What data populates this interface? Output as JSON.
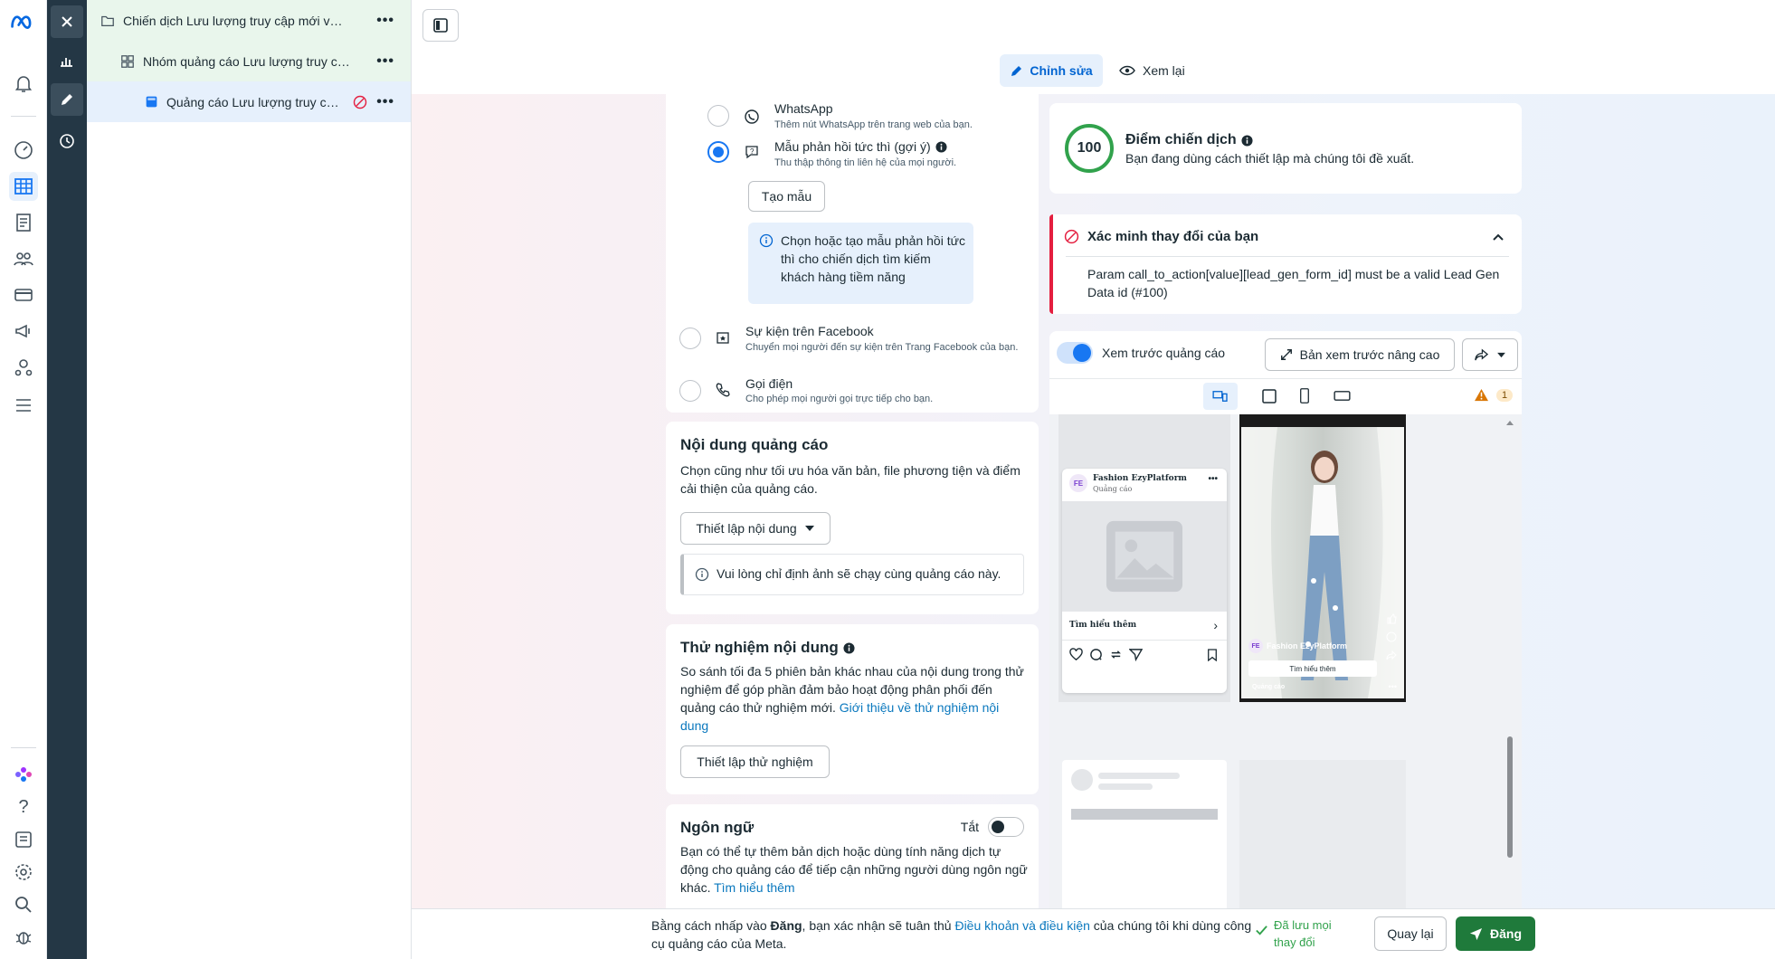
{
  "tree": {
    "campaign": "Chiến dịch Lưu lượng truy cập mới với ...",
    "adset": "Nhóm quảng cáo Lưu lượng truy cậ...",
    "ad": "Quảng cáo Lưu lượng truy câ...",
    "more": "•••"
  },
  "tabs": {
    "edit": "Chỉnh sửa",
    "review": "Xem lại"
  },
  "destinations": {
    "whatsapp_title": "WhatsApp",
    "whatsapp_desc": "Thêm nút WhatsApp trên trang web của bạn.",
    "instant_title": "Mẫu phản hồi tức thì (gợi ý)",
    "instant_desc": "Thu thập thông tin liên hệ của mọi người.",
    "create_form": "Tạo mẫu",
    "info": "Chọn hoặc tạo mẫu phản hồi tức thì cho chiến dịch tìm kiếm khách hàng tiềm năng",
    "event_title": "Sự kiện trên Facebook",
    "event_desc": "Chuyển mọi người đến sự kiện trên Trang Facebook của bạn.",
    "call_title": "Gọi điện",
    "call_desc": "Cho phép mọi người gọi trực tiếp cho bạn."
  },
  "ad_content": {
    "title": "Nội dung quảng cáo",
    "desc": "Chọn cũng như tối ưu hóa văn bản, file phương tiện và điểm cải thiện của quảng cáo.",
    "setup": "Thiết lập nội dung",
    "notice": "Vui lòng chỉ định ảnh sẽ chạy cùng quảng cáo này."
  },
  "content_test": {
    "title": "Thử nghiệm nội dung",
    "desc": "So sánh tối đa 5 phiên bản khác nhau của nội dung trong thử nghiệm để góp phần đảm bảo hoạt động phân phối đến quảng cáo thử nghiệm mới.",
    "link": "Giới thiệu về thử nghiệm nội dung",
    "button": "Thiết lập thử nghiệm"
  },
  "language": {
    "title": "Ngôn ngữ",
    "toggle": "Tắt",
    "desc": "Bạn có thể tự thêm bản dịch hoặc dùng tính năng dịch tự động cho quảng cáo để tiếp cận những người dùng ngôn ngữ khác.",
    "link": "Tìm hiểu thêm"
  },
  "score": {
    "value": "100",
    "title": "Điểm chiến dịch",
    "desc": "Bạn đang dùng cách thiết lập mà chúng tôi đề xuất."
  },
  "verify": {
    "title": "Xác minh thay đổi của bạn",
    "error": "Param call_to_action[value][lead_gen_form_id] must be a valid Lead Gen Data id (#100)"
  },
  "preview": {
    "toggle_label": "Xem trước quảng cáo",
    "advanced": "Bản xem trước nâng cao",
    "warning_count": "1",
    "page_name": "Fashion EzyPlatform",
    "sponsored": "Quảng cáo",
    "cta": "Tìm hiểu thêm",
    "logo": "FE"
  },
  "footer": {
    "terms_prefix": "Bằng cách nhấp vào ",
    "terms_bold": "Đăng",
    "terms_mid": ", bạn xác nhận sẽ tuân thủ ",
    "terms_link": "Điều khoản và điều kiện",
    "terms_suffix": " của chúng tôi khi dùng công cụ quảng cáo của Meta.",
    "saved": "Đã lưu mọi thay đổi",
    "back": "Quay lại",
    "publish": "Đăng"
  },
  "colors": {
    "primary": "#1877f2",
    "publish": "#1f7a3b",
    "error": "#e41e3f",
    "score_ring": "#31a24c"
  }
}
